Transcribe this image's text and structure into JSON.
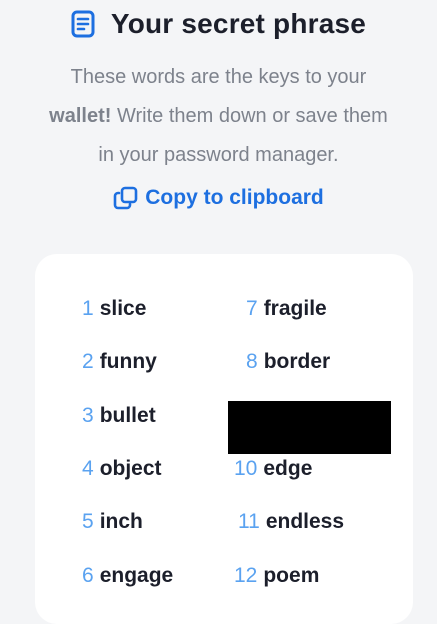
{
  "header": {
    "title": "Your secret phrase",
    "icon": "document-icon"
  },
  "description": {
    "part1": "These words are the keys to your",
    "strong": "wallet!",
    "part2": "Write them down or save them",
    "part3": "in your password manager."
  },
  "copy": {
    "label": "Copy to clipboard",
    "icon": "copy-icon"
  },
  "phrase": {
    "words": [
      {
        "num": "1",
        "word": "slice"
      },
      {
        "num": "2",
        "word": "funny"
      },
      {
        "num": "3",
        "word": "bullet"
      },
      {
        "num": "4",
        "word": "object"
      },
      {
        "num": "5",
        "word": "inch"
      },
      {
        "num": "6",
        "word": "engage"
      },
      {
        "num": "7",
        "word": "fragile"
      },
      {
        "num": "8",
        "word": "border"
      },
      {
        "num": "10",
        "word": "edge"
      },
      {
        "num": "11",
        "word": "endless"
      },
      {
        "num": "12",
        "word": "poem"
      }
    ]
  },
  "colors": {
    "accent": "#1d6fe0",
    "number": "#5aa2f0",
    "text": "#1c1f2b",
    "muted": "#7d828c",
    "background": "#f4f5f7",
    "card": "#ffffff"
  }
}
